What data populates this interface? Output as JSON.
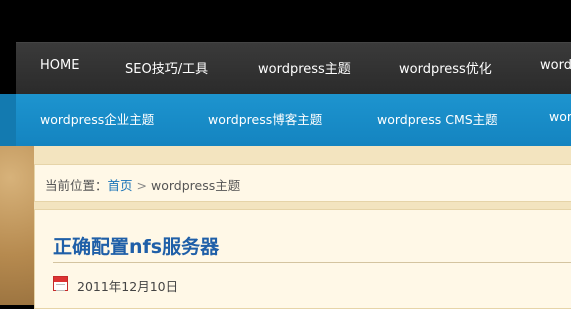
{
  "main_nav": {
    "items": [
      "HOME",
      "SEO技巧/工具",
      "wordpress主题",
      "wordpress优化",
      "word"
    ]
  },
  "sub_nav": {
    "items": [
      "wordpress企业主题",
      "wordpress博客主题",
      "wordpress CMS主题",
      "wor"
    ]
  },
  "breadcrumb": {
    "prefix": "当前位置：",
    "home": "首页",
    "separator": ">",
    "current": "wordpress主题"
  },
  "post": {
    "title": "正确配置nfs服务器",
    "date": "2011年12月10日"
  },
  "colors": {
    "main_nav_bg": "#2f2f2f",
    "sub_nav_bg": "#1a8fcc",
    "link": "#1b74b8",
    "title": "#1f5fa8"
  },
  "icons": {
    "date": "calendar-icon"
  }
}
